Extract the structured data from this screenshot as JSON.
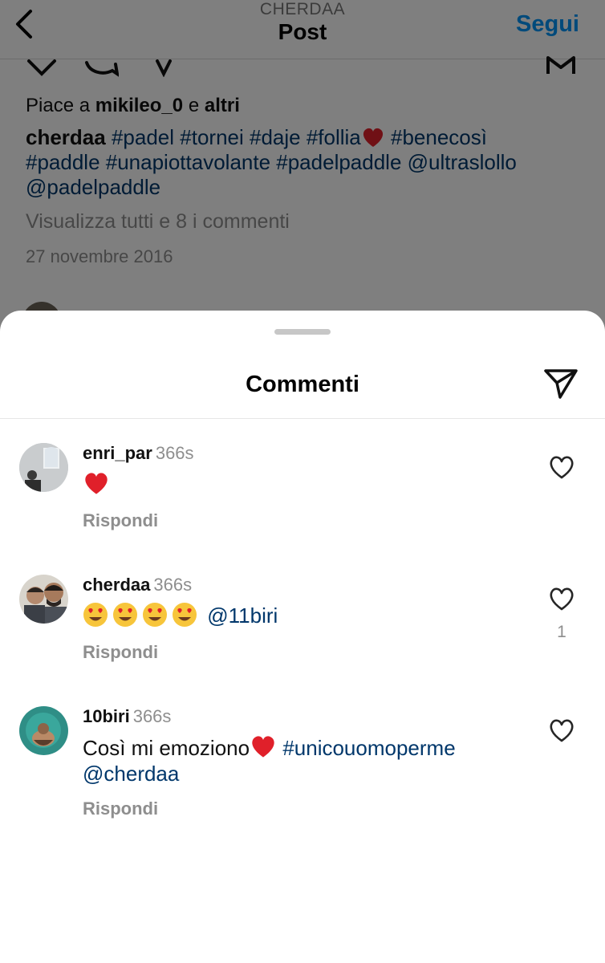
{
  "header": {
    "account": "CHERDAA",
    "title": "Post",
    "follow_label": "Segui"
  },
  "post": {
    "likes_prefix": "Piace a",
    "likes_user": "mikileo_0",
    "likes_mid": "e",
    "likes_suffix": "altri",
    "caption_user": "cherdaa",
    "caption_line1": "#padel #tornei #daje #follia",
    "caption_line1b": "#benecosì",
    "caption_line2": "#paddle #unapiottavolante #padelpaddle @ultraslollo",
    "caption_line3": "@padelpaddle",
    "view_all": "Visualizza tutti e 8 i commenti",
    "date": "27 novembre 2016"
  },
  "sheet": {
    "title": "Commenti"
  },
  "comments": [
    {
      "user": "enri_par",
      "time": "366s",
      "text": "",
      "reply": "Rispondi",
      "likes": ""
    },
    {
      "user": "cherdaa",
      "time": "366s",
      "mention": "@11biri",
      "reply": "Rispondi",
      "likes": "1"
    },
    {
      "user": "10biri",
      "time": "366s",
      "text": "Così mi emoziono",
      "tag": "#unicouomoperme",
      "mention": "@cherdaa",
      "reply": "Rispondi",
      "likes": ""
    }
  ],
  "colors": {
    "link": "#00376b",
    "follow": "#0095f6",
    "muted": "#8e8e8e",
    "heart": "#e0202a"
  },
  "icons": [
    "chevron-left-icon",
    "heart-outline-icon",
    "paper-plane-icon",
    "comment-icon",
    "bookmark-icon",
    "heart-emoji-icon",
    "heart-eyes-emoji-icon"
  ]
}
